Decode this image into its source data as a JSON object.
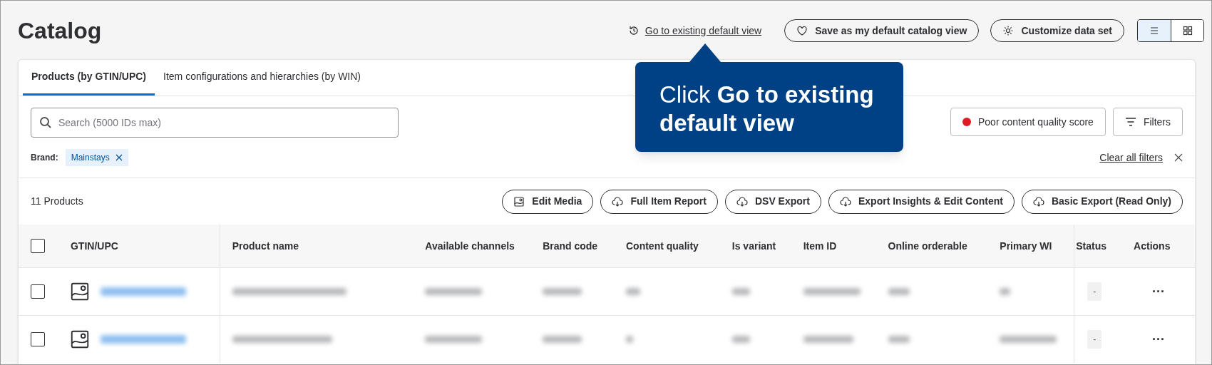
{
  "page_title": "Catalog",
  "header_link": "Go to existing default view",
  "header_buttons": [
    {
      "kind": "heart",
      "label": "Save as my default catalog view"
    },
    {
      "kind": "gear",
      "label": "Customize data set"
    }
  ],
  "view_toggle": [
    {
      "kind": "list",
      "selected": true
    },
    {
      "kind": "grid",
      "selected": false
    }
  ],
  "tabs": [
    {
      "label": "Products (by GTIN/UPC)",
      "selected": true
    },
    {
      "label": "Item configurations and hierarchies (by WIN)",
      "selected": false
    }
  ],
  "search": {
    "placeholder": "Search (5000 IDs max)"
  },
  "quality_filter": {
    "label": "Poor content quality score",
    "color": "#de1c24"
  },
  "filters_button": "Filters",
  "active_filters": [
    {
      "label": "Brand:",
      "value": "Mainstays"
    }
  ],
  "clear_filters": "Clear all filters",
  "product_count": "11 Products",
  "export_buttons": [
    {
      "kind": "image",
      "label": "Edit Media"
    },
    {
      "kind": "cloud",
      "label": "Full Item Report"
    },
    {
      "kind": "cloud",
      "label": "DSV Export"
    },
    {
      "kind": "cloud",
      "label": "Export Insights & Edit Content"
    },
    {
      "kind": "cloud",
      "label": "Basic Export (Read Only)"
    }
  ],
  "table": {
    "select_all_checked": false,
    "columns": [
      "GTIN/UPC",
      "Product name",
      "Available channels",
      "Brand code",
      "Content quality",
      "Is variant",
      "Item ID",
      "Online orderable",
      "Primary WI",
      "Status",
      "Actions"
    ],
    "rows": [
      {
        "checked": false,
        "status": "-",
        "actions": "···"
      },
      {
        "checked": false,
        "status": "-",
        "actions": "···"
      }
    ]
  },
  "tooltip": "Click **Go to existing default view**"
}
